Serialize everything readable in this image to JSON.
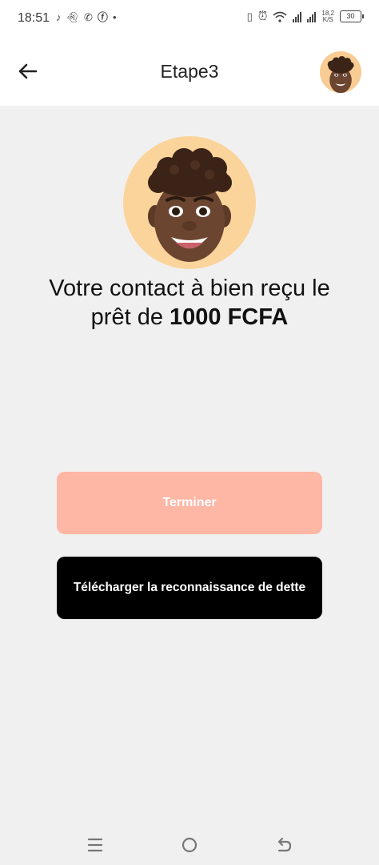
{
  "status_bar": {
    "time": "18:51",
    "network_speed_value": "18,2",
    "network_speed_unit": "K/S",
    "battery": "30"
  },
  "header": {
    "title": "Etape3"
  },
  "main": {
    "message_prefix": "Votre contact à bien reçu le prêt de ",
    "amount": "1000 FCFA"
  },
  "buttons": {
    "finish": "Terminer",
    "download": "Télécharger la reconnaissance de dette"
  },
  "colors": {
    "finish_button": "#feb6a5",
    "download_button": "#000000",
    "avatar_background": "#fad49b",
    "page_background": "#f1f0f1"
  }
}
